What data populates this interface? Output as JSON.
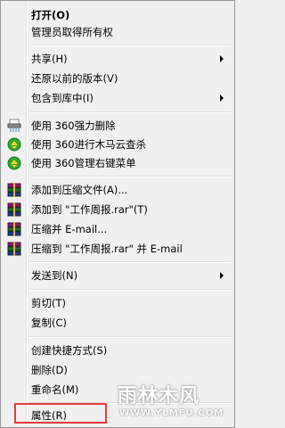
{
  "menu": {
    "items": [
      {
        "label": "打开(O)",
        "bold": true
      },
      {
        "label": "管理员取得所有权"
      },
      {
        "label": "共享(H)",
        "submenu": true
      },
      {
        "label": "还原以前的版本(V)"
      },
      {
        "label": "包含到库中(I)",
        "submenu": true
      },
      {
        "label": "使用 360强力删除",
        "icon": "shredder-icon"
      },
      {
        "label": "使用 360进行木马云查杀",
        "icon": "360-shield-icon"
      },
      {
        "label": "使用 360管理右键菜单",
        "icon": "360-shield-icon"
      },
      {
        "label": "添加到压缩文件(A)...",
        "icon": "winrar-icon"
      },
      {
        "label": "添加到 \"工作周报.rar\"(T)",
        "icon": "winrar-icon"
      },
      {
        "label": "压缩并 E-mail...",
        "icon": "winrar-icon"
      },
      {
        "label": "压缩到 \"工作周报.rar\" 并 E-mail",
        "icon": "winrar-icon"
      },
      {
        "label": "发送到(N)",
        "submenu": true
      },
      {
        "label": "剪切(T)"
      },
      {
        "label": "复制(C)"
      },
      {
        "label": "创建快捷方式(S)"
      },
      {
        "label": "删除(D)"
      },
      {
        "label": "重命名(M)"
      },
      {
        "label": "属性(R)"
      }
    ]
  },
  "watermark": {
    "title": "雨林木风",
    "url": "WWW.YLMFU.COM"
  },
  "colors": {
    "menu_bg": "#f0f0f0",
    "highlight_border": "#e23b3b",
    "separator": "#e0e0e0"
  }
}
